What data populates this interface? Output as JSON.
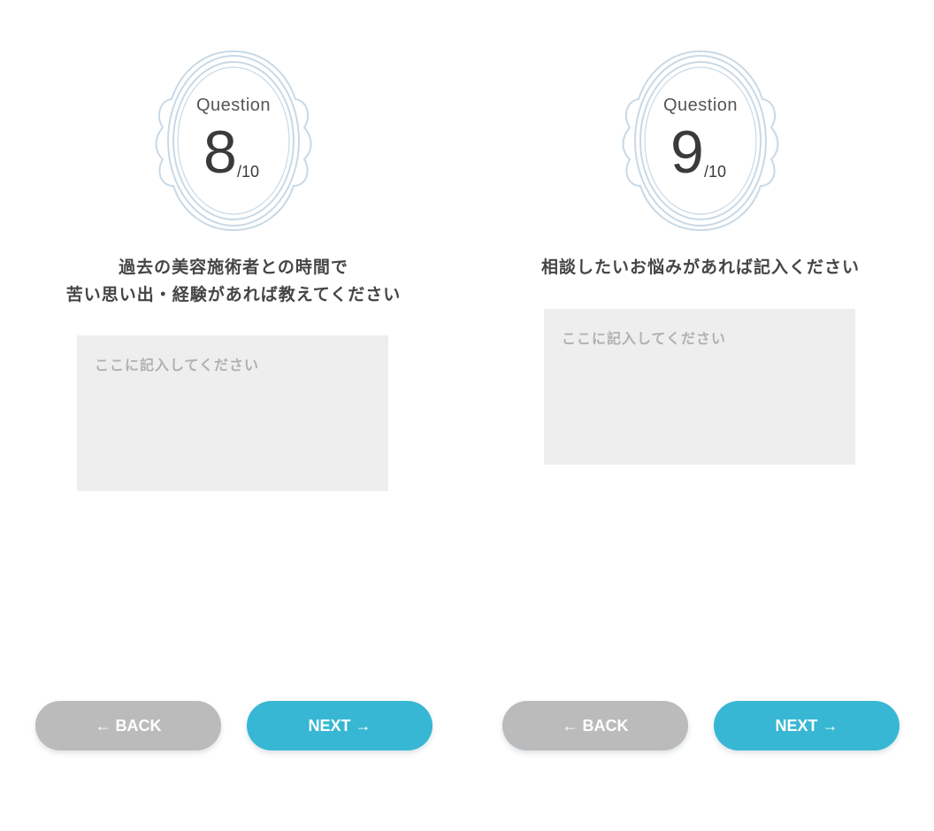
{
  "frame_label": "Question",
  "panels": [
    {
      "question_number": "8",
      "total": "/10",
      "question_lines": [
        "過去の美容施術者との時間で",
        "苦い思い出・経験があれば教えてください"
      ],
      "answer_placeholder": "ここに記入してください",
      "back_label": "← BACK",
      "next_label": "NEXT →"
    },
    {
      "question_number": "9",
      "total": "/10",
      "question_lines": [
        "相談したいお悩みがあれば記入ください"
      ],
      "answer_placeholder": "ここに記入してください",
      "back_label": "← BACK",
      "next_label": "NEXT →"
    }
  ],
  "colors": {
    "frame_stroke": "#c8d9e6",
    "input_bg": "#eeeeee",
    "back_button": "#bbbbbb",
    "next_button": "#37b7d3"
  },
  "icons": [
    "ornate-frame-icon",
    "arrow-left-icon",
    "arrow-right-icon"
  ]
}
